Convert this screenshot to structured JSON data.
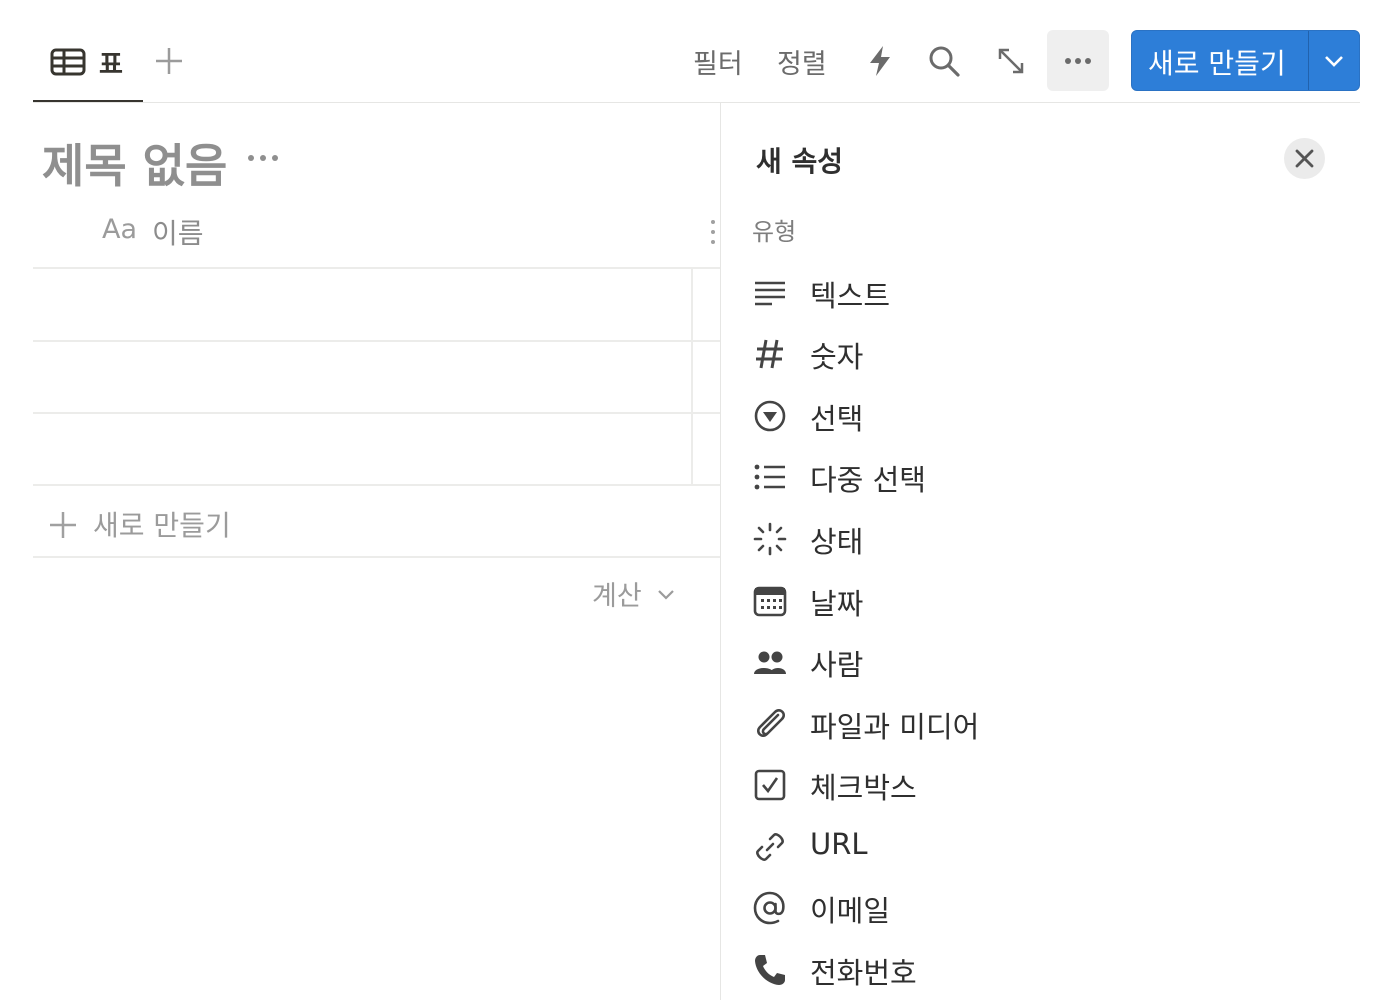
{
  "toolbar": {
    "active_view_label": "표",
    "filter_label": "필터",
    "sort_label": "정렬",
    "new_button_label": "새로 만들기"
  },
  "database": {
    "title": "제목 없음",
    "name_column_icon": "Aa",
    "name_column_label": "이름",
    "rows": [
      "",
      "",
      ""
    ],
    "add_row_label": "새로 만들기",
    "calculate_label": "계산"
  },
  "panel": {
    "title": "새 속성",
    "section_label": "유형",
    "types": [
      {
        "label": "텍스트",
        "icon": "text-icon"
      },
      {
        "label": "숫자",
        "icon": "number-icon"
      },
      {
        "label": "선택",
        "icon": "select-icon"
      },
      {
        "label": "다중 선택",
        "icon": "multi-select-icon"
      },
      {
        "label": "상태",
        "icon": "status-icon"
      },
      {
        "label": "날짜",
        "icon": "calendar-icon"
      },
      {
        "label": "사람",
        "icon": "people-icon"
      },
      {
        "label": "파일과 미디어",
        "icon": "paperclip-icon"
      },
      {
        "label": "체크박스",
        "icon": "checkbox-icon"
      },
      {
        "label": "URL",
        "icon": "link-icon"
      },
      {
        "label": "이메일",
        "icon": "at-icon"
      },
      {
        "label": "전화번호",
        "icon": "phone-icon"
      }
    ]
  },
  "colors": {
    "accent": "#2d7ed8",
    "text": "#37352f",
    "muted": "#9b9b9b",
    "divider": "#ececea"
  }
}
